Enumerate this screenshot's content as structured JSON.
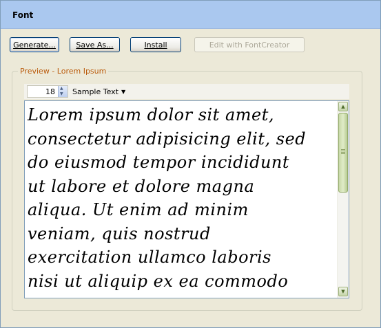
{
  "window": {
    "title": "Font"
  },
  "buttons": {
    "generate": "Generate...",
    "save_as": "Save As...",
    "install": "Install",
    "edit_fontcreator": "Edit with FontCreator"
  },
  "preview": {
    "group_label": "Preview - Lorem Ipsum",
    "size_value": "18",
    "sample_label": "Sample Text",
    "lines": [
      "Lorem ipsum dolor sit amet,",
      "consectetur adipisicing elit, sed",
      "do eiusmod tempor incididunt",
      "ut labore et dolore magna",
      "aliqua. Ut enim ad minim",
      "veniam, quis nostrud",
      "exercitation ullamco laboris",
      "nisi ut aliquip ex ea commodo"
    ]
  },
  "icons": {
    "dropdown": "caret-down-icon",
    "spin_up": "spin-up-icon",
    "spin_down": "spin-down-icon",
    "scroll_up": "scroll-up-icon",
    "scroll_down": "scroll-down-icon"
  },
  "colors": {
    "titlebar": "#aac8ef",
    "group_label": "#ba5b0c",
    "window_bg": "#ece9d8"
  }
}
